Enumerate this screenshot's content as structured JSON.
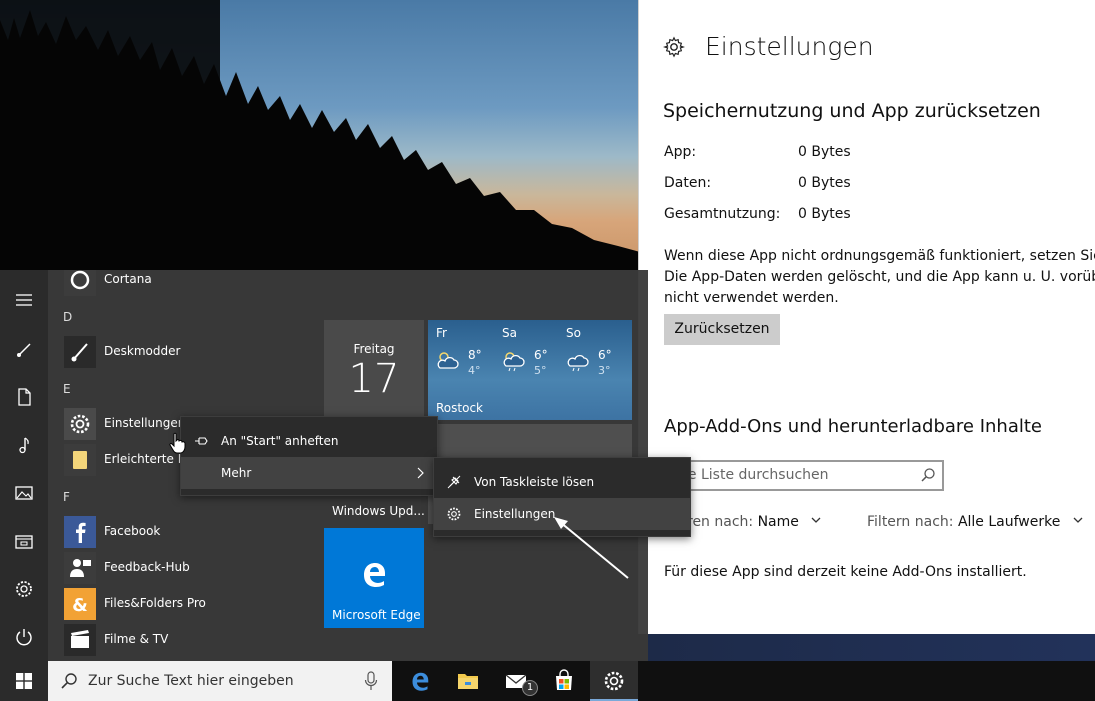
{
  "settings": {
    "title": "Einstellungen",
    "storage_heading": "Speichernutzung und App zurücksetzen",
    "rows": [
      {
        "label": "App:",
        "value": "0 Bytes"
      },
      {
        "label": "Daten:",
        "value": "0 Bytes"
      },
      {
        "label": "Gesamtnutzung:",
        "value": "0 Bytes"
      }
    ],
    "reset_description": "Wenn diese App nicht ordnungsgemäß funktioniert, setzen Sie sie zurück. Die App-Daten werden gelöscht, und die App kann u. U. vorübergehend nicht verwendet werden.",
    "reset_button": "Zurücksetzen",
    "addons_heading": "App-Add-Ons und herunterladbare Inhalte",
    "search_placeholder": "ese Liste durchsuchen",
    "sort_label": "tieren nach:",
    "sort_value": "Name",
    "filter_label": "Filtern nach:",
    "filter_value": "Alle Laufwerke",
    "no_addons": "Für diese App sind derzeit keine Add-Ons installiert."
  },
  "start_menu": {
    "letters": {
      "d": "D",
      "e": "E",
      "f": "F"
    },
    "apps": {
      "cortana": "Cortana",
      "deskmodder": "Deskmodder",
      "einstellungen": "Einstellungen",
      "erleichterte": "Erleichterte Be",
      "facebook": "Facebook",
      "feedback": "Feedback-Hub",
      "filesfolders": "Files&Folders Pro",
      "filme": "Filme & TV"
    },
    "tiles": {
      "calendar_day": "Freitag",
      "calendar_date": "17",
      "weather_city": "Rostock",
      "weather": [
        {
          "day": "Fr",
          "hi": "8°",
          "lo": "4°"
        },
        {
          "day": "Sa",
          "hi": "6°",
          "lo": "5°"
        },
        {
          "day": "So",
          "hi": "6°",
          "lo": "3°"
        }
      ],
      "windows_update": "Windows Upd...",
      "edge": "Microsoft Edge"
    }
  },
  "context_menu": {
    "pin_start": "An \"Start\" anheften",
    "more": "Mehr"
  },
  "submenu": {
    "unpin_taskbar": "Von Taskleiste lösen",
    "settings": "Einstellungen"
  },
  "taskbar": {
    "search_placeholder": "Zur Suche Text hier eingeben",
    "mail_badge": "1"
  },
  "colors": {
    "accent": "#0078d7",
    "start_bg": "#3a3a3a",
    "menu_bg": "#2b2b2b",
    "taskbar_bg": "#101010"
  }
}
